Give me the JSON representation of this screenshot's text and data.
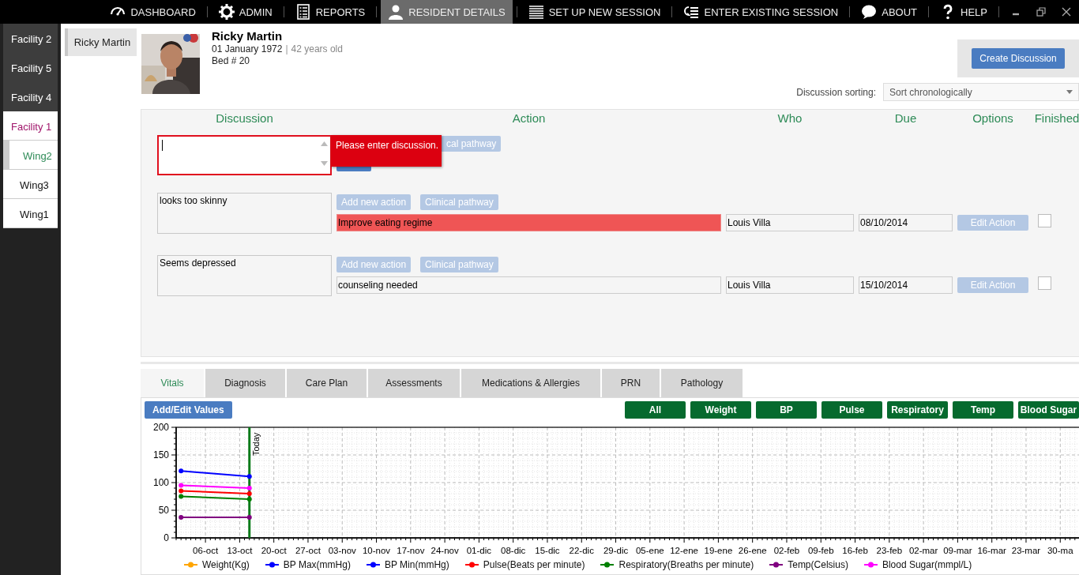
{
  "nav": {
    "items": [
      {
        "label": "DASHBOARD",
        "selected": false
      },
      {
        "label": "ADMIN",
        "selected": false
      },
      {
        "label": "REPORTS",
        "selected": false
      },
      {
        "label": "RESIDENT DETAILS",
        "selected": true
      },
      {
        "label": "SET UP NEW SESSION",
        "selected": false
      },
      {
        "label": "ENTER EXISTING SESSION",
        "selected": false
      },
      {
        "label": "ABOUT",
        "selected": false
      },
      {
        "label": "HELP",
        "selected": false
      }
    ]
  },
  "sidebar": {
    "facilities": [
      {
        "label": "Facility 2",
        "selected": false
      },
      {
        "label": "Facility 5",
        "selected": false
      },
      {
        "label": "Facility 4",
        "selected": false
      },
      {
        "label": "Facility 1",
        "selected": true,
        "children": [
          {
            "label": "Wing2",
            "selected": true
          },
          {
            "label": "Wing3",
            "selected": false
          },
          {
            "label": "Wing1",
            "selected": false
          }
        ]
      }
    ]
  },
  "residents": [
    {
      "label": "Ricky Martin",
      "selected": true
    }
  ],
  "resident": {
    "name": "Ricky Martin",
    "dob": "01 January 1972",
    "separator": "|",
    "age": "42 years old",
    "bed": "Bed # 20"
  },
  "create_button": "Create Discussion",
  "sorting": {
    "label": "Discussion sorting:",
    "value": "Sort chronologically"
  },
  "discussions": {
    "columns": [
      "Discussion",
      "Action",
      "Who",
      "Due",
      "Options",
      "Finished"
    ],
    "new_entry": {
      "focused": true,
      "error": "Please enter discussion.",
      "visible_button": "cal pathway"
    },
    "rows": [
      {
        "text": "looks too skinny",
        "buttons": [
          "Add new action",
          "Clinical pathway"
        ],
        "action": "Improve eating regime",
        "overdue": true,
        "who": "Louis Villa",
        "due": "08/10/2014",
        "edit": "Edit Action",
        "finished": false
      },
      {
        "text": "Seems depressed",
        "buttons": [
          "Add new action",
          "Clinical pathway"
        ],
        "action": "counseling needed",
        "overdue": false,
        "who": "Louis Villa",
        "due": "15/10/2014",
        "edit": "Edit Action",
        "finished": false
      }
    ]
  },
  "tabs": [
    {
      "label": "Vitals",
      "selected": true
    },
    {
      "label": "Diagnosis",
      "selected": false
    },
    {
      "label": "Care Plan",
      "selected": false
    },
    {
      "label": "Assessments",
      "selected": false
    },
    {
      "label": "Medications & Allergies",
      "selected": false
    },
    {
      "label": "PRN",
      "selected": false
    },
    {
      "label": "Pathology",
      "selected": false
    }
  ],
  "vitals": {
    "add_button": "Add/Edit Values",
    "filters": [
      "All",
      "Weight",
      "BP",
      "Pulse",
      "Respiratory",
      "Temp",
      "Blood Sugar"
    ],
    "chart_data": {
      "type": "line",
      "x": [
        "2014-10-01",
        "2014-10-15"
      ],
      "series": [
        {
          "name": "Weight(Kg)",
          "color": "#ffa500",
          "values": [
            null,
            null
          ]
        },
        {
          "name": "BP Max(mmHg)",
          "color": "#0000ff",
          "marker": "o",
          "values": [
            121,
            111
          ]
        },
        {
          "name": "BP Min(mmHg)",
          "color": "#0000ff",
          "values": [
            null,
            null
          ]
        },
        {
          "name": "Pulse(Beats per minute)",
          "color": "#ff0000",
          "marker": "o",
          "values": [
            85,
            80
          ]
        },
        {
          "name": "Respiratory(Breaths per minute)",
          "color": "#008000",
          "marker": "o",
          "values": [
            75,
            70
          ]
        },
        {
          "name": "Temp(Celsius)",
          "color": "#800080",
          "marker": "o",
          "values": [
            37,
            37
          ]
        },
        {
          "name": "Blood Sugar(mmpl/L)",
          "color": "#ff00ff",
          "marker": "o",
          "values": [
            95,
            90
          ]
        }
      ],
      "grid": true,
      "xlim": [
        "2014-09-30",
        "2015-04-03"
      ],
      "ylim": [
        0,
        200
      ],
      "yticks": [
        0,
        50,
        100,
        150,
        200
      ],
      "xticks": [
        {
          "value": "2014-10-06",
          "label": "06-oct"
        },
        {
          "value": "2014-10-13",
          "label": "13-oct"
        },
        {
          "value": "2014-10-20",
          "label": "20-oct"
        },
        {
          "value": "2014-10-27",
          "label": "27-oct"
        },
        {
          "value": "2014-11-03",
          "label": "03-nov"
        },
        {
          "value": "2014-11-10",
          "label": "10-nov"
        },
        {
          "value": "2014-11-17",
          "label": "17-nov"
        },
        {
          "value": "2014-11-24",
          "label": "24-nov"
        },
        {
          "value": "2014-12-01",
          "label": "01-dic"
        },
        {
          "value": "2014-12-08",
          "label": "08-dic"
        },
        {
          "value": "2014-12-15",
          "label": "15-dic"
        },
        {
          "value": "2014-12-22",
          "label": "22-dic"
        },
        {
          "value": "2014-12-29",
          "label": "29-dic"
        },
        {
          "value": "2015-01-05",
          "label": "05-ene"
        },
        {
          "value": "2015-01-12",
          "label": "12-ene"
        },
        {
          "value": "2015-01-19",
          "label": "19-ene"
        },
        {
          "value": "2015-01-26",
          "label": "26-ene"
        },
        {
          "value": "2015-02-02",
          "label": "02-feb"
        },
        {
          "value": "2015-02-09",
          "label": "09-feb"
        },
        {
          "value": "2015-02-16",
          "label": "16-feb"
        },
        {
          "value": "2015-02-23",
          "label": "23-feb"
        },
        {
          "value": "2015-03-02",
          "label": "02-mar"
        },
        {
          "value": "2015-03-09",
          "label": "09-mar"
        },
        {
          "value": "2015-03-16",
          "label": "16-mar"
        },
        {
          "value": "2015-03-23",
          "label": "23-mar"
        },
        {
          "value": "2015-03-30",
          "label": "30-ma"
        }
      ],
      "ref_lines": [
        {
          "axis": "x",
          "value": "2014-10-15",
          "label": "Today",
          "color": "#0a7a1a"
        }
      ]
    }
  }
}
